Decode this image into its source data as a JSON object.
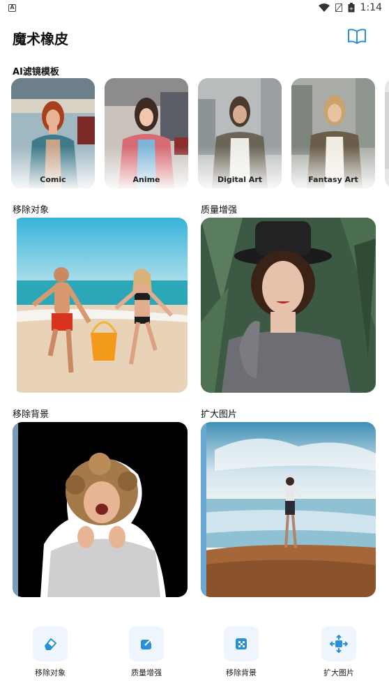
{
  "status_bar": {
    "time": "1:14",
    "left_icon": "A"
  },
  "header": {
    "title": "魔术橡皮",
    "book_icon": "book-icon"
  },
  "ai_filters": {
    "title": "AI滤镜模板",
    "items": [
      {
        "label": "Comic"
      },
      {
        "label": "Anime"
      },
      {
        "label": "Digital Art"
      },
      {
        "label": "Fantasy Art"
      }
    ]
  },
  "features": {
    "remove_object": "移除对象",
    "enhance_quality": "质量增强",
    "remove_background": "移除背景",
    "expand_image": "扩大图片"
  },
  "bottom_nav": {
    "items": [
      {
        "label": "移除对象",
        "icon": "eraser-icon"
      },
      {
        "label": "质量增强",
        "icon": "enhance-icon"
      },
      {
        "label": "移除背景",
        "icon": "checker-icon"
      },
      {
        "label": "扩大图片",
        "icon": "expand-icon"
      }
    ]
  },
  "colors": {
    "accent": "#2b8fd6",
    "nav_bg": "#eef5fc"
  }
}
